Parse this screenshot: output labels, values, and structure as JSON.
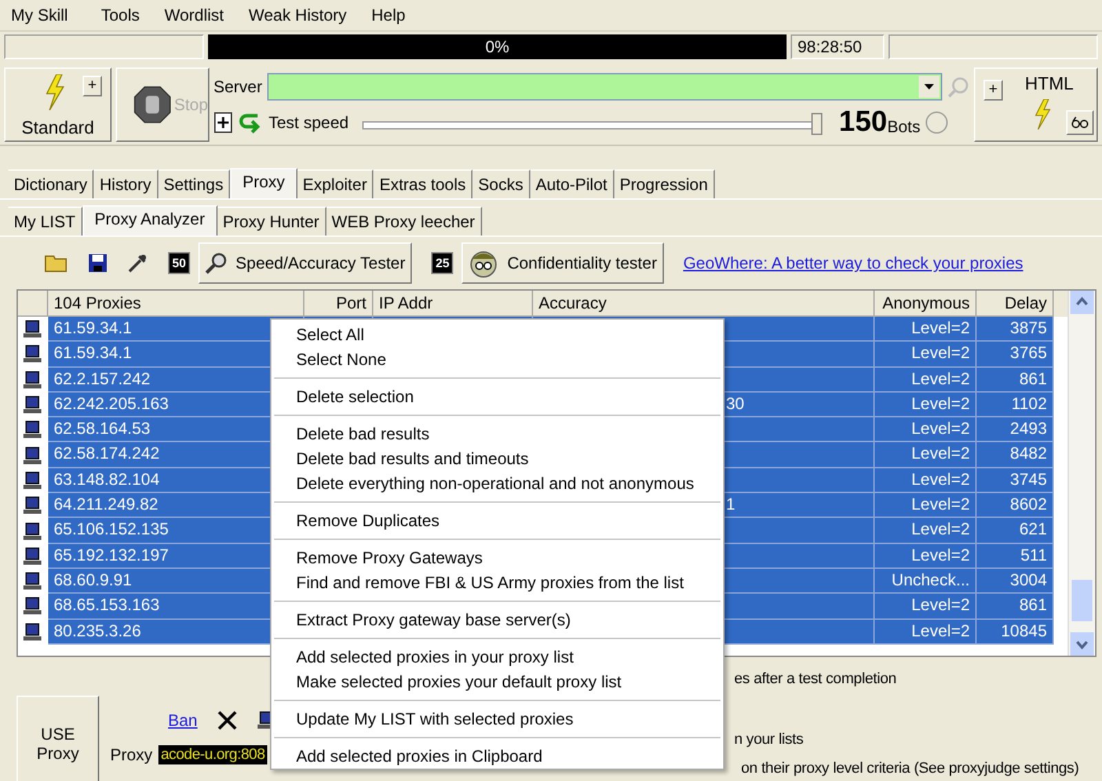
{
  "menu_bar": [
    "My Skill",
    "Tools",
    "Wordlist",
    "Weak History",
    "Help"
  ],
  "progress": {
    "text": "0%",
    "level": 0,
    "time": "98:28:50"
  },
  "toolbar": {
    "standard": "Standard",
    "plus": "+",
    "stop": "Stop",
    "server_label": "Server",
    "test_speed": "Test speed",
    "speed_slider": {
      "level": 1
    },
    "bots_count": "150",
    "bots_label": "Bots",
    "bots_radio": {
      "selected": false
    },
    "html_plus": "+",
    "html": "HTML"
  },
  "tabs": [
    {
      "label": "Dictionary",
      "selected": false
    },
    {
      "label": "History",
      "selected": false
    },
    {
      "label": "Settings",
      "selected": false
    },
    {
      "label": "Proxy",
      "selected": true
    },
    {
      "label": "Exploiter",
      "selected": false
    },
    {
      "label": "Extras tools",
      "selected": false
    },
    {
      "label": "Socks",
      "selected": false
    },
    {
      "label": "Auto-Pilot",
      "selected": false
    },
    {
      "label": "Progression",
      "selected": false
    }
  ],
  "subtabs": [
    {
      "label": "My LIST",
      "selected": false
    },
    {
      "label": "Proxy Analyzer",
      "selected": true
    },
    {
      "label": "Proxy Hunter",
      "selected": false
    },
    {
      "label": "WEB Proxy leecher",
      "selected": false
    }
  ],
  "tools": {
    "count_a": "50",
    "speed_button": "Speed/Accuracy Tester",
    "count_b": "25",
    "confidentiality_button": "Confidentiality tester",
    "link": "GeoWhere: A better way to check your proxies"
  },
  "table": {
    "columns": [
      "104 Proxies",
      "Port",
      "IP Addr",
      "Accuracy",
      "Anonymous",
      "Delay"
    ],
    "rows": [
      {
        "proxy": "61.59.34.1",
        "anonymous": "Level=2",
        "delay": "3875",
        "selected": true
      },
      {
        "proxy": "61.59.34.1",
        "anonymous": "Level=2",
        "delay": "3765",
        "selected": true
      },
      {
        "proxy": "62.2.157.242",
        "anonymous": "Level=2",
        "delay": "861",
        "selected": true
      },
      {
        "proxy": "62.242.205.163",
        "accuracy": "30",
        "anonymous": "Level=2",
        "delay": "1102",
        "selected": true
      },
      {
        "proxy": "62.58.164.53",
        "anonymous": "Level=2",
        "delay": "2493",
        "selected": true
      },
      {
        "proxy": "62.58.174.242",
        "anonymous": "Level=2",
        "delay": "8482",
        "selected": true
      },
      {
        "proxy": "63.148.82.104",
        "anonymous": "Level=2",
        "delay": "3745",
        "selected": true
      },
      {
        "proxy": "64.211.249.82",
        "accuracy": "1",
        "anonymous": "Level=2",
        "delay": "8602",
        "selected": true
      },
      {
        "proxy": "65.106.152.135",
        "anonymous": "Level=2",
        "delay": "621",
        "selected": true
      },
      {
        "proxy": "65.192.132.197",
        "anonymous": "Level=2",
        "delay": "511",
        "selected": true
      },
      {
        "proxy": "68.60.9.91",
        "anonymous": "Uncheck...",
        "delay": "3004",
        "selected": true
      },
      {
        "proxy": "68.65.153.163",
        "anonymous": "Level=2",
        "delay": "861",
        "selected": true
      },
      {
        "proxy": "80.235.3.26",
        "anonymous": "Level=2",
        "delay": "10845",
        "selected": true
      }
    ]
  },
  "bottom": {
    "use_proxy": "USE Proxy",
    "ban": "Ban",
    "proxy_label": "Proxy",
    "proxy_value": "acode-u.org:808",
    "notes": [
      "es after a test completion",
      "n your lists",
      "on their proxy level criteria (See proxyjudge settings)"
    ]
  },
  "context_menu": [
    [
      "Select All",
      "Select None"
    ],
    [
      "Delete selection"
    ],
    [
      "Delete bad results",
      "Delete bad results and timeouts",
      "Delete everything non-operational and not anonymous"
    ],
    [
      "Remove Duplicates"
    ],
    [
      "Remove Proxy Gateways",
      "Find and remove FBI & US Army proxies from the list"
    ],
    [
      "Extract Proxy gateway base server(s)"
    ],
    [
      "Add selected proxies in your proxy list",
      "Make selected proxies your default proxy list"
    ],
    [
      "Update My LIST with selected proxies"
    ],
    [
      "Add selected proxies in Clipboard"
    ]
  ]
}
